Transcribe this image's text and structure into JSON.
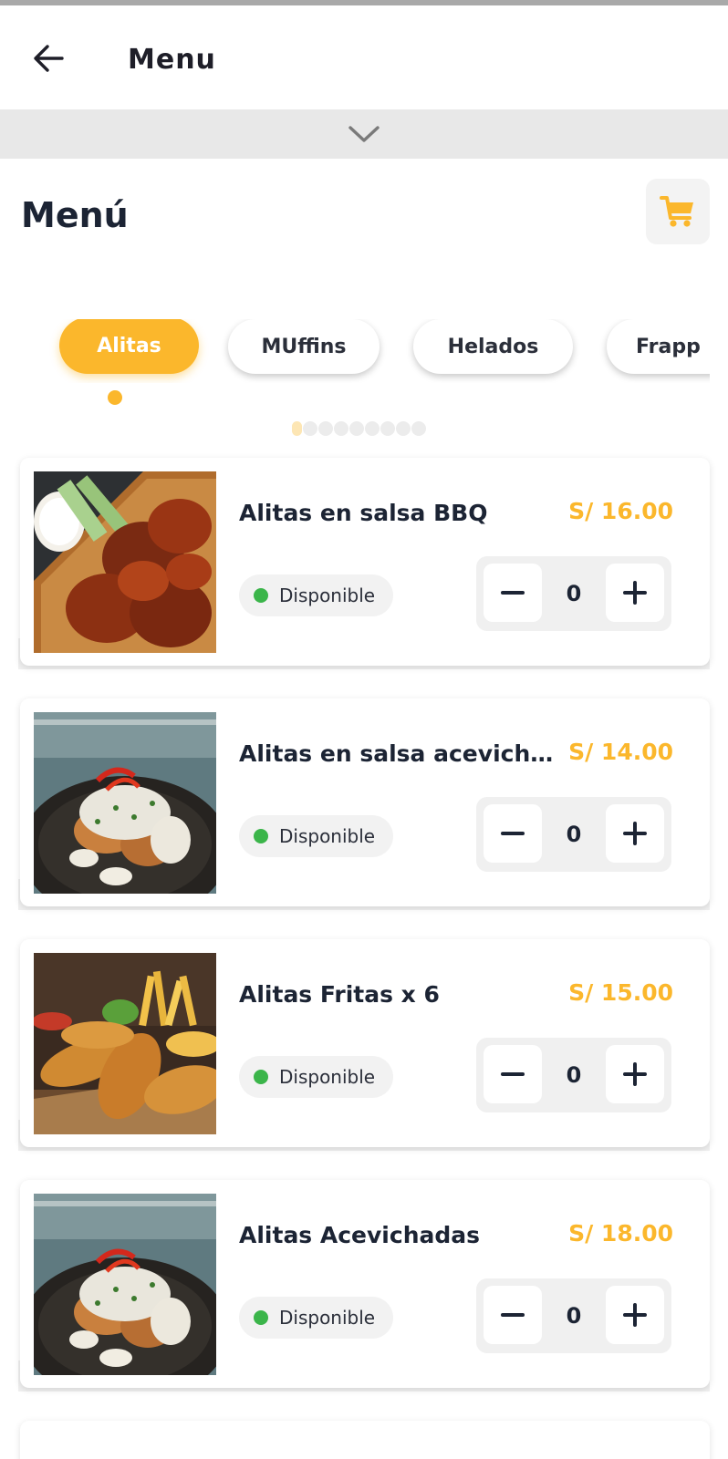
{
  "appbar": {
    "title": "Menu",
    "back_icon": "arrow-left-icon"
  },
  "collapse": {
    "icon": "chevron-down-icon"
  },
  "page": {
    "heading": "Menú",
    "cart_icon": "cart-icon"
  },
  "colors": {
    "accent": "#fbb72c",
    "available": "#3bb54a",
    "text": "#1c2434"
  },
  "categories": {
    "items": [
      {
        "label": "Alitas",
        "selected": true
      },
      {
        "label": "MUffins",
        "selected": false
      },
      {
        "label": "Helados",
        "selected": false
      },
      {
        "label": "Frapp",
        "selected": false
      }
    ],
    "pager": {
      "total": 9,
      "current": 1
    }
  },
  "products": [
    {
      "name": "Alitas en salsa BBQ",
      "price": "S/ 16.00",
      "status": "Disponible",
      "quantity": "0",
      "image": "bbq-wings-photo"
    },
    {
      "name": "Alitas en salsa acevichada",
      "price": "S/ 14.00",
      "status": "Disponible",
      "quantity": "0",
      "image": "acevichada-wings-photo"
    },
    {
      "name": "Alitas Fritas x 6",
      "price": "S/ 15.00",
      "status": "Disponible",
      "quantity": "0",
      "image": "fried-wings-photo"
    },
    {
      "name": "Alitas Acevichadas",
      "price": "S/ 18.00",
      "status": "Disponible",
      "quantity": "0",
      "image": "acevichada-wings-photo"
    }
  ]
}
